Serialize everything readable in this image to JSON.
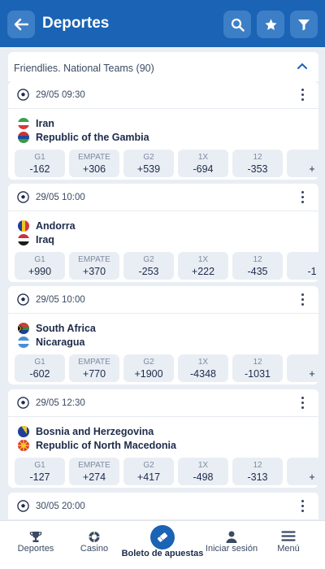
{
  "header": {
    "title": "Deportes"
  },
  "section": {
    "title": "Friendlies. National Teams (90)"
  },
  "matches": [
    {
      "datetime": "29/05 09:30",
      "team1": "Iran",
      "team2": "Republic of the Gambia",
      "odds": [
        {
          "label": "G1",
          "value": "-162"
        },
        {
          "label": "EMPATE",
          "value": "+306"
        },
        {
          "label": "G2",
          "value": "+539"
        },
        {
          "label": "1X",
          "value": "-694"
        },
        {
          "label": "12",
          "value": "-353"
        },
        {
          "label": "",
          "value": "+"
        }
      ]
    },
    {
      "datetime": "29/05 10:00",
      "team1": "Andorra",
      "team2": "Iraq",
      "odds": [
        {
          "label": "G1",
          "value": "+990"
        },
        {
          "label": "EMPATE",
          "value": "+370"
        },
        {
          "label": "G2",
          "value": "-253"
        },
        {
          "label": "1X",
          "value": "+222"
        },
        {
          "label": "12",
          "value": "-435"
        },
        {
          "label": "",
          "value": "-1"
        }
      ]
    },
    {
      "datetime": "29/05 10:00",
      "team1": "South Africa",
      "team2": "Nicaragua",
      "odds": [
        {
          "label": "G1",
          "value": "-602"
        },
        {
          "label": "EMPATE",
          "value": "+770"
        },
        {
          "label": "G2",
          "value": "+1900"
        },
        {
          "label": "1X",
          "value": "-4348"
        },
        {
          "label": "12",
          "value": "-1031"
        },
        {
          "label": "",
          "value": "+"
        }
      ]
    },
    {
      "datetime": "29/05 12:30",
      "team1": "Bosnia and Herzegovina",
      "team2": "Republic of North Macedonia",
      "odds": [
        {
          "label": "G1",
          "value": "-127"
        },
        {
          "label": "EMPATE",
          "value": "+274"
        },
        {
          "label": "G2",
          "value": "+417"
        },
        {
          "label": "1X",
          "value": "-498"
        },
        {
          "label": "12",
          "value": "-313"
        },
        {
          "label": "",
          "value": "+"
        }
      ]
    },
    {
      "datetime": "30/05 20:00"
    }
  ],
  "bottom_nav": [
    {
      "label": "Deportes",
      "icon": "trophy-icon"
    },
    {
      "label": "Casino",
      "icon": "casino-chip-icon"
    },
    {
      "label": "Boleto de apuestas",
      "icon": "ticket-icon"
    },
    {
      "label": "Iniciar sesión",
      "icon": "user-icon"
    },
    {
      "label": "Menú",
      "icon": "menu-icon"
    }
  ],
  "colors": {
    "primary": "#1a63b5",
    "button": "#3d7fc6",
    "background": "#e9eef4",
    "text": "#1d2b4a"
  }
}
